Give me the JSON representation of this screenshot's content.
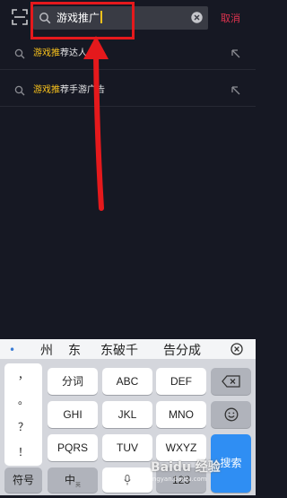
{
  "header": {
    "scan_icon": "scan-icon",
    "search": {
      "value": "游戏推广",
      "icon": "search-icon"
    },
    "clear_icon": "clear-icon",
    "cancel_label": "取消"
  },
  "suggestions": [
    {
      "highlight": "游戏推",
      "rest": "荐达人"
    },
    {
      "highlight": "游戏推",
      "rest": "荐手游广告"
    }
  ],
  "candidates": {
    "items": [
      "州",
      "东",
      "东破千",
      "告分成"
    ],
    "close_icon": "close-circle-icon"
  },
  "keyboard": {
    "punctuation": [
      "，",
      "。",
      "？",
      "！"
    ],
    "row1": [
      "分词",
      "ABC",
      "DEF"
    ],
    "row2": [
      "GHI",
      "JKL",
      "MNO"
    ],
    "row3": [
      "PQRS",
      "TUV",
      "WXYZ"
    ],
    "bottom": {
      "symbols": "符号",
      "lang": "中",
      "lang_sub": "英",
      "num": "123",
      "search": "搜索"
    },
    "backspace_icon": "backspace-icon",
    "emoji_icon": "emoji-icon",
    "mic_icon": "mic-icon"
  },
  "watermark": {
    "main": "Baidu 经验",
    "sub": "jingyan.baidu.com"
  },
  "colors": {
    "accent_yellow": "#f9c21c",
    "cancel_red": "#e0334f",
    "annotation_red": "#e5191c",
    "key_blue": "#2f8ef3"
  }
}
